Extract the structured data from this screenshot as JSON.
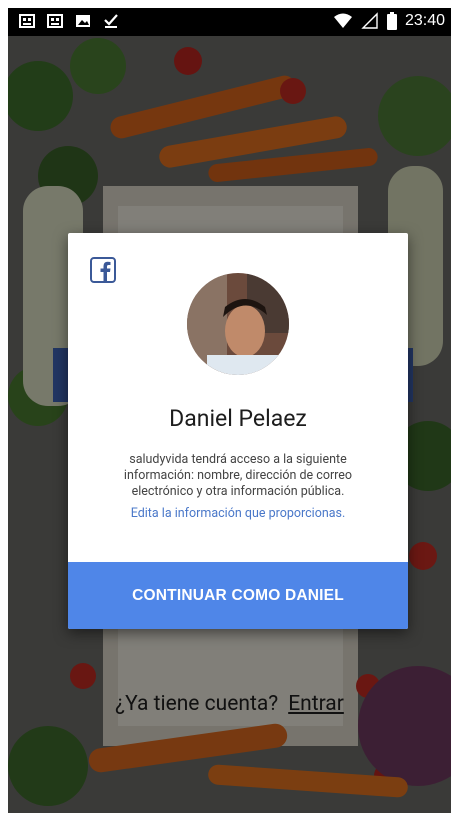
{
  "status_bar": {
    "time": "23:40",
    "left_icons": [
      "app-notification-icon",
      "app-notification-icon",
      "image-icon",
      "download-done-icon"
    ],
    "right_icons": [
      "wifi-icon",
      "signal-icon",
      "battery-icon"
    ]
  },
  "background": {
    "account_prompt": "¿Ya tiene cuenta?",
    "login_link": "Entrar"
  },
  "dialog": {
    "user_name": "Daniel Pelaez",
    "info_text": "saludyvida tendrá acceso a la siguiente información: nombre, dirección de correo electrónico y otra información pública.",
    "edit_link": "Edita la información que proporcionas.",
    "continue_button": "CONTINUAR COMO DANIEL",
    "brand_color": "#4f86e8",
    "facebook_color": "#3b5998"
  }
}
